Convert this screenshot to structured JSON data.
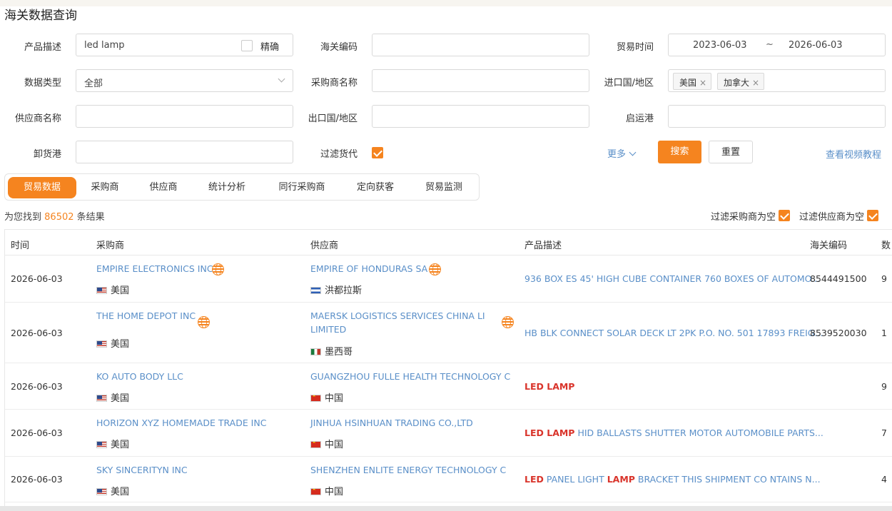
{
  "page_title": "海关数据查询",
  "form": {
    "product_desc": {
      "label": "产品描述",
      "value": "led lamp",
      "exact_label": "精确"
    },
    "hs_code": {
      "label": "海关编码",
      "value": ""
    },
    "trade_time": {
      "label": "贸易时间",
      "start": "2023-06-03",
      "sep": "~",
      "end": "2026-06-03"
    },
    "data_type": {
      "label": "数据类型",
      "value": "全部"
    },
    "buyer_name": {
      "label": "采购商名称",
      "value": ""
    },
    "import_country": {
      "label": "进口国/地区",
      "tags": [
        "美国",
        "加拿大"
      ]
    },
    "supplier_name": {
      "label": "供应商名称",
      "value": ""
    },
    "export_country": {
      "label": "出口国/地区",
      "value": ""
    },
    "departure_port": {
      "label": "启运港",
      "value": ""
    },
    "unloading_port": {
      "label": "卸货港",
      "value": ""
    },
    "filter_forwarder": {
      "label": "过滤货代",
      "checked": true
    },
    "more_label": "更多",
    "search_label": "搜索",
    "reset_label": "重置",
    "video_link": "查看视频教程"
  },
  "tabs": [
    "贸易数据",
    "采购商",
    "供应商",
    "统计分析",
    "同行采购商",
    "定向获客",
    "贸易监测"
  ],
  "result": {
    "prefix": "为您找到",
    "count": "86502",
    "suffix": "条结果"
  },
  "filters": {
    "empty_buyer": "过滤采购商为空",
    "empty_supplier": "过滤供应商为空"
  },
  "table": {
    "headers": [
      "时间",
      "采购商",
      "供应商",
      "产品描述",
      "海关编码",
      "数"
    ],
    "rows": [
      {
        "date": "2026-06-03",
        "buyer": "EMPIRE ELECTRONICS INC",
        "buyer_country": "美国",
        "supplier": "EMPIRE OF HONDURAS SA",
        "supplier_country": "洪都拉斯",
        "desc": [
          {
            "t": "936 BOX ES 45' HIGH CUBE CONTAINER 760 BOXES OF AUTOMO...",
            "h": false
          }
        ],
        "hs": "8544491500",
        "qty": "9"
      },
      {
        "date": "2026-06-03",
        "buyer": "THE HOME DEPOT INC",
        "buyer_country": "美国",
        "supplier": "MAERSK LOGISTICS SERVICES CHINA LI",
        "supplier_line2": "LIMITED",
        "supplier_country": "墨西哥",
        "desc": [
          {
            "t": "HB BLK CONNECT SOLAR DECK LT 2PK P.O. NO. 501 17893 FREIG...",
            "h": false
          }
        ],
        "hs": "8539520030",
        "qty": "1"
      },
      {
        "date": "2026-06-03",
        "buyer": "KO AUTO BODY LLC",
        "buyer_country": "美国",
        "supplier": "GUANGZHOU FULLE HEALTH TECHNOLOGY C",
        "supplier_country": "中国",
        "desc": [
          {
            "t": "LED LAMP",
            "h": true
          }
        ],
        "hs": "",
        "qty": "9"
      },
      {
        "date": "2026-06-03",
        "buyer": "HORIZON XYZ HOMEMADE TRADE INC",
        "buyer_country": "美国",
        "supplier": "JINHUA HSINHUAN TRADING CO.,LTD",
        "supplier_country": "中国",
        "desc": [
          {
            "t": "LED LAMP",
            "h": true
          },
          {
            "t": " HID BALLASTS SHUTTER MOTOR AUTOMOBILE PARTS...",
            "h": false
          }
        ],
        "hs": "",
        "qty": "7"
      },
      {
        "date": "2026-06-03",
        "buyer": "SKY SINCERITYN INC",
        "buyer_country": "美国",
        "supplier": "SHENZHEN ENLITE ENERGY TECHNOLOGY C",
        "supplier_country": "中国",
        "desc": [
          {
            "t": "LED",
            "h": true
          },
          {
            "t": " PANEL LIGHT ",
            "h": false
          },
          {
            "t": "LAMP",
            "h": true
          },
          {
            "t": " BRACKET THIS SHIPMENT CO NTAINS N...",
            "h": false
          }
        ],
        "hs": "",
        "qty": "4"
      }
    ]
  },
  "colors": {
    "accent": "#f5841f",
    "link": "#5a8fc8",
    "highlight": "#d9342b"
  }
}
